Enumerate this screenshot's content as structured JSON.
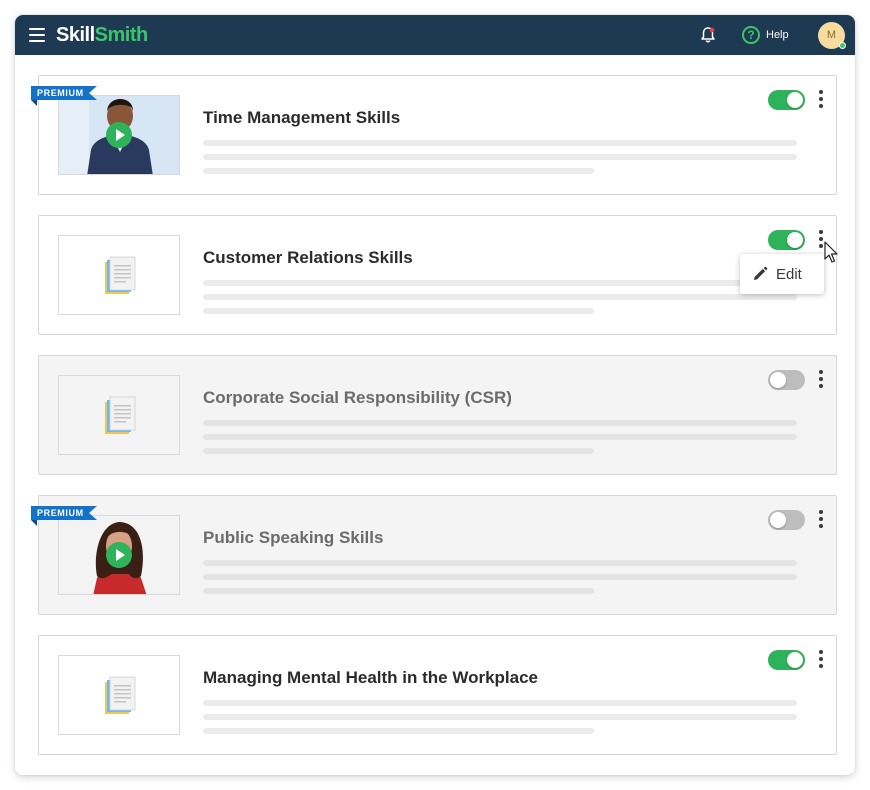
{
  "app": {
    "logo": {
      "part1": "Skill",
      "part2": "Smith"
    },
    "help_label": "Help",
    "avatar_initial": "M"
  },
  "colors": {
    "topbar": "#1e3a52",
    "accent_green": "#2fb35a",
    "premium_blue": "#1473c8"
  },
  "badge_label": "PREMIUM",
  "courses": [
    {
      "title": "Time Management Skills",
      "enabled": true,
      "premium": true,
      "thumbnail": "video-man"
    },
    {
      "title": "Customer Relations Skills",
      "enabled": true,
      "premium": false,
      "thumbnail": "document-icon"
    },
    {
      "title": "Corporate Social Responsibility (CSR)",
      "enabled": false,
      "premium": false,
      "thumbnail": "document-icon"
    },
    {
      "title": "Public Speaking Skills",
      "enabled": false,
      "premium": true,
      "thumbnail": "video-woman"
    },
    {
      "title": "Managing Mental Health in the Workplace",
      "enabled": true,
      "premium": false,
      "thumbnail": "document-icon"
    }
  ],
  "popover": {
    "edit_label": "Edit"
  }
}
